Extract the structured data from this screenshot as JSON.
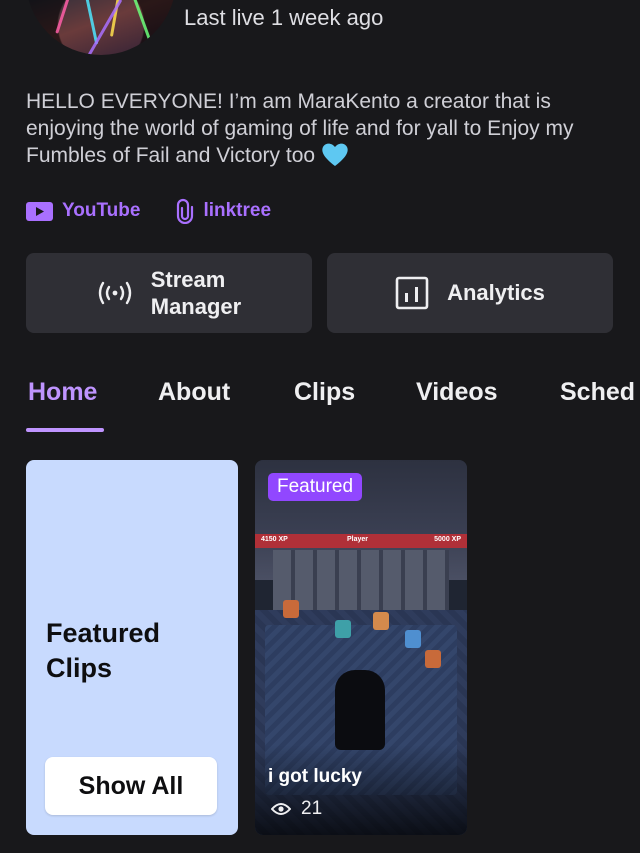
{
  "profile": {
    "last_live": "Last live 1 week ago",
    "bio": "HELLO EVERYONE! I’m am MaraKento a creator that is enjoying the world of gaming  of life and for yall to Enjoy my Fumbles of Fail and Victory too"
  },
  "social_links": [
    {
      "label": "YouTube",
      "icon": "youtube-icon"
    },
    {
      "label": "linktree",
      "icon": "link-icon"
    }
  ],
  "actions": {
    "stream_manager_line1": "Stream",
    "stream_manager_line2": "Manager",
    "analytics": "Analytics"
  },
  "tabs": [
    {
      "label": "Home",
      "active": true
    },
    {
      "label": "About",
      "active": false
    },
    {
      "label": "Clips",
      "active": false
    },
    {
      "label": "Videos",
      "active": false
    },
    {
      "label": "Sched",
      "active": false
    }
  ],
  "featured_clips": {
    "title_line1": "Featured",
    "title_line2": "Clips",
    "show_all": "Show All"
  },
  "clip": {
    "badge": "Featured",
    "title": "i got lucky",
    "views": "21",
    "hud_left": "4150 XP",
    "hud_mid": "Player",
    "hud_right": "5000 XP"
  },
  "colors": {
    "accent": "#bf94ff",
    "link": "#a970ff",
    "badge": "#9147ff",
    "featured_bg": "#c8dafe",
    "background": "#18181b",
    "card": "#2f2f35"
  }
}
